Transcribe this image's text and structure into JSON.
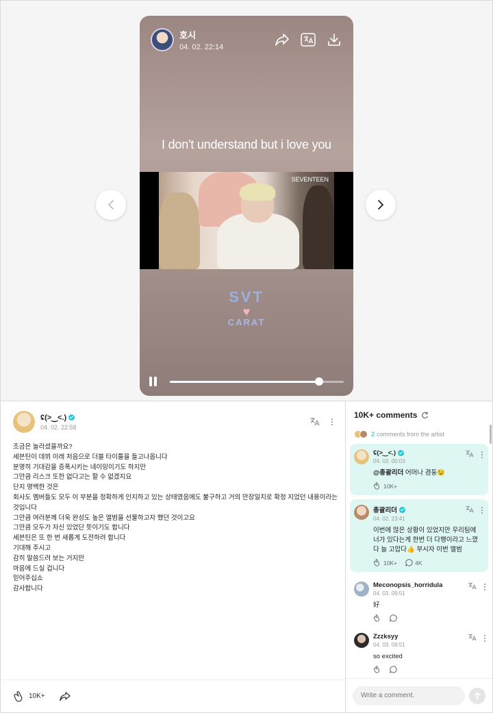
{
  "media": {
    "author_name": "호시",
    "date": "04. 02. 22:14",
    "caption": "I don't understand but i love you",
    "video_logo": "SEVENTEEN",
    "sticker": {
      "line1": "SVT",
      "line2": "CARAT"
    },
    "progress": 0.86,
    "icons": [
      "share-icon",
      "translate-icon",
      "download-icon",
      "pause-icon"
    ]
  },
  "post": {
    "author_name": "ʢ(>‿<.)",
    "date": "04. 02. 22:58",
    "lines": [
      "조금은 놀라셨을까요?",
      "세븐틴이 데뷔 이래 처음으로 더블 타이틀을 들고나옵니다",
      "분명히 기대감을 증폭시키는 네이밍이기도 하지만",
      "그만큼 리스크 또한 없다고는 할 수 없겠지요",
      "단지 명백한 것은",
      "회사도 멤버들도 모두 이 부분을 정확하게 인지하고 있는 상태였음에도 불구하고 거의 만장일치로 확정 지었던 내용이라는",
      "것입니다",
      "그만큼 여러분께 더욱 완성도 높은 앨범을 선물하고자 했던 것이고요",
      "그만큼 모두가 자신 있었단 뜻이기도 합니다",
      "세븐틴은 또 한 번 새롭게 도전하려 합니다",
      "기대해 주시고",
      "감히 말씀드려 보는 거지만",
      "마음에 드실 겁니다",
      "믿어주십쇼",
      "감사합니다"
    ],
    "like_count": "10K+"
  },
  "comments": {
    "title": "10K+ comments",
    "artist_count": "2",
    "artist_label": "comments from the artist",
    "items": [
      {
        "name": "ʢ(>‿<.)",
        "date": "04. 03. 00:03",
        "mention": "@총괄리더",
        "text": " 어머나 겸둥😉",
        "likes": "10K+",
        "replies": ""
      },
      {
        "name": "총괄리더",
        "date": "04. 02. 23:41",
        "text": "이번에 많은 상황이 있었지만 우리팀에 너가 있다는게 한번 더 다행이라고 느꼈다 늘 고맙다👍 부시자 이번 앨범",
        "likes": "10K+",
        "replies": "4K"
      },
      {
        "name": "Meconopsis_horridula",
        "date": "04. 03. 09:51",
        "text": "好",
        "likes": "",
        "replies": ""
      },
      {
        "name": "Zzzksyy",
        "date": "04. 03. 09:51",
        "text": "so excited",
        "likes": "",
        "replies": ""
      }
    ],
    "input_placeholder": "Write a comment."
  },
  "colors": {
    "artist_bg": "#dff7f2",
    "accent": "#1fb3c2",
    "verified": "#26c6da"
  }
}
